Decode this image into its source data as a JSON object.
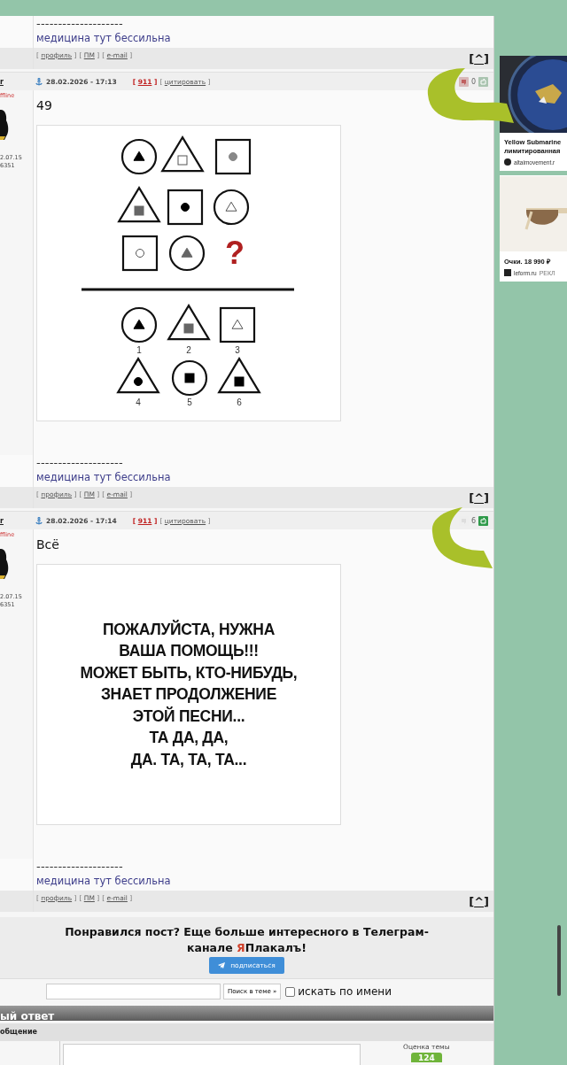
{
  "previous_post": {
    "signature_rule": "--------------------",
    "signature": "медицина тут бессильна",
    "footer_links": [
      {
        "open": "[",
        "text": "профиль",
        "close": "]"
      },
      {
        "open": "[",
        "text": "ПМ",
        "close": "]"
      },
      {
        "open": "[",
        "text": "e-mail",
        "close": "]"
      }
    ],
    "top_link": {
      "open": "[",
      "text": "^",
      "close": "]"
    }
  },
  "posts": [
    {
      "author": "r",
      "status": "ffline",
      "joined": "2.07.15",
      "count": "6351",
      "date": "28.02.2026 - 17:13",
      "header_links": [
        {
          "kind": "number",
          "open": "[",
          "text": "911",
          "close": "]"
        },
        {
          "kind": "quote",
          "open": "[",
          "text": "цитировать",
          "close": "]"
        }
      ],
      "rating": "0",
      "liked": false,
      "text": "49",
      "image": {
        "kind": "puzzle",
        "question": "?",
        "option_labels": [
          "1",
          "2",
          "3",
          "4",
          "5",
          "6"
        ]
      },
      "signature_rule": "--------------------",
      "signature": "медицина тут бессильна",
      "footer_links": [
        {
          "open": "[",
          "text": "профиль",
          "close": "]"
        },
        {
          "open": "[",
          "text": "ПМ",
          "close": "]"
        },
        {
          "open": "[",
          "text": "e-mail",
          "close": "]"
        }
      ],
      "top_link": {
        "open": "[",
        "text": "^",
        "close": "]"
      }
    },
    {
      "author": "r",
      "status": "ffline",
      "joined": "2.07.15",
      "count": "6351",
      "date": "28.02.2026 - 17:14",
      "header_links": [
        {
          "kind": "number",
          "open": "[",
          "text": "911",
          "close": "]"
        },
        {
          "kind": "quote",
          "open": "[",
          "text": "цитировать",
          "close": "]"
        }
      ],
      "rating": "6",
      "liked": true,
      "text": "Всё",
      "image": {
        "kind": "meme",
        "lines": [
          "ПОЖАЛУЙСТА, НУЖНА",
          "ВАША ПОМОЩЬ!!!",
          "МОЖЕТ БЫТЬ, КТО-НИБУДЬ,",
          "ЗНАЕТ ПРОДОЛЖЕНИЕ",
          "ЭТОЙ ПЕСНИ...",
          "ТА ДА, ДА,",
          "ДА. ТА, ТА, ТА..."
        ]
      },
      "signature_rule": "--------------------",
      "signature": "медицина тут бессильна",
      "footer_links": [
        {
          "open": "[",
          "text": "профиль",
          "close": "]"
        },
        {
          "open": "[",
          "text": "ПМ",
          "close": "]"
        },
        {
          "open": "[",
          "text": "e-mail",
          "close": "]"
        }
      ],
      "top_link": {
        "open": "[",
        "text": "^",
        "close": "]"
      }
    }
  ],
  "promo": {
    "title_parts": [
      {
        "text": "Понравился пост? Еще больше интересного в Телеграм-канале "
      },
      {
        "text": "Я",
        "color": "#d0402a"
      },
      {
        "text": "Плакалъ!"
      }
    ],
    "button": "подписаться"
  },
  "search": {
    "button": "Поиск в теме »",
    "checkbox_label": "искать по имени",
    "checked": false
  },
  "quick_reply": {
    "title": "ый ответ",
    "subheader": "общение",
    "rating_label": "Оценка темы",
    "rating_value": "124"
  },
  "ads": [
    {
      "kind": "watch",
      "title_lines": [
        "Yellow Submarine",
        "лимитированная"
      ],
      "source": "altaimovement.r"
    },
    {
      "kind": "glasses",
      "title_lines": [
        "Очки. 18 990 ₽"
      ],
      "source": "leform.ru",
      "tag": "РЕКЛ"
    }
  ]
}
